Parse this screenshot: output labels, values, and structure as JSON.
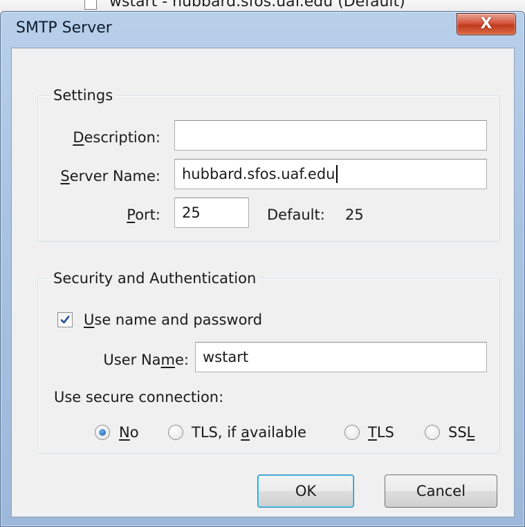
{
  "background": {
    "partial_text": "wstart - hubbard.sfos.uaf.edu (Default)"
  },
  "dialog": {
    "title": "SMTP Server",
    "close_glyph": "X"
  },
  "settings": {
    "legend": "Settings",
    "description": {
      "pre": "",
      "key": "D",
      "post": "escription:",
      "value": ""
    },
    "server_name": {
      "pre": "",
      "key": "S",
      "post": "erver Name:",
      "value": "hubbard.sfos.uaf.edu"
    },
    "port": {
      "pre": "",
      "key": "P",
      "post": "ort:",
      "value": "25"
    },
    "default": {
      "label": "Default:",
      "value": "25"
    }
  },
  "security": {
    "legend": "Security and Authentication",
    "use_name_password": {
      "pre": "",
      "key": "U",
      "post": "se name and password",
      "checked": true
    },
    "user_name": {
      "pre": "User Na",
      "key": "m",
      "post": "e:",
      "value": "wstart"
    },
    "secure_connection_label": "Use secure connection:",
    "options": [
      {
        "pre": "",
        "key": "N",
        "post": "o",
        "selected": true
      },
      {
        "pre": "TLS, if ",
        "key": "a",
        "post": "vailable",
        "selected": false
      },
      {
        "pre": "",
        "key": "T",
        "post": "LS",
        "selected": false
      },
      {
        "pre": "SS",
        "key": "L",
        "post": "",
        "selected": false
      }
    ]
  },
  "buttons": {
    "ok": "OK",
    "cancel": "Cancel"
  },
  "colors": {
    "frame": "#a9c3e2",
    "client": "#f0f0f0",
    "close": "#c23b20",
    "default_button_border": "#3c7fb1"
  },
  "icons": {
    "close": "close-icon",
    "checkbox": "checkmark-icon",
    "radio": "radio-dot-icon"
  }
}
